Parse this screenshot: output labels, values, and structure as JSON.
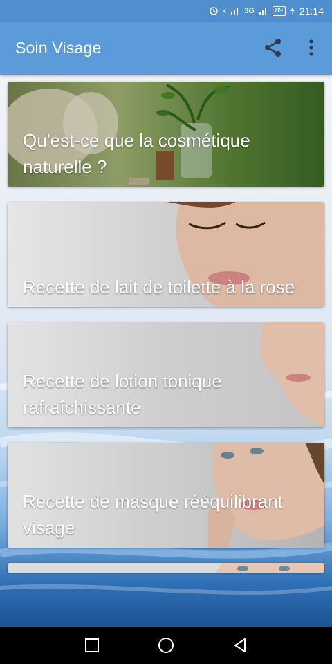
{
  "status_bar": {
    "time": "21:14",
    "network_1": "x",
    "network_2": "3G",
    "battery": "89"
  },
  "app_bar": {
    "title": "Soin Visage",
    "share_icon": "share-icon",
    "more_icon": "more-vert-icon"
  },
  "cards": [
    {
      "title": "Qu'est-ce que la cosmétique naturelle ?"
    },
    {
      "title": "Recette de lait de toilette à la rose"
    },
    {
      "title": "Recette de lotion tonique rafraîchissante"
    },
    {
      "title": "Recette de masque rééquilibrant visage"
    }
  ],
  "nav_bar": {
    "recents_icon": "square-icon",
    "home_icon": "circle-icon",
    "back_icon": "triangle-back-icon"
  },
  "colors": {
    "app_bar": "#5b9bd9",
    "status_bar": "#4f8fcf",
    "nav_bar": "#000000"
  }
}
